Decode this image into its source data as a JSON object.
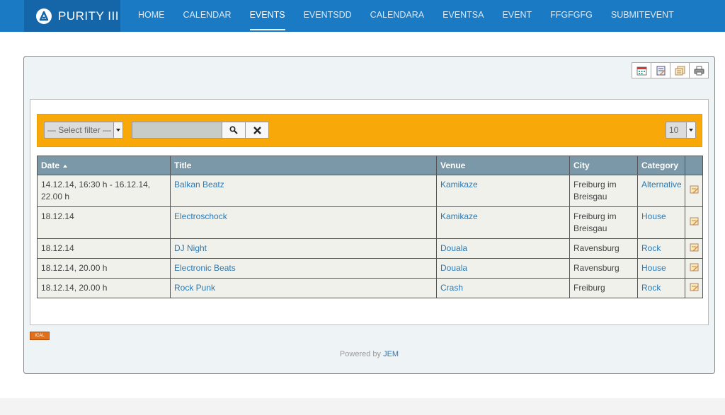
{
  "brand": {
    "name": "PURITY III"
  },
  "nav": [
    {
      "label": "HOME"
    },
    {
      "label": "CALENDAR"
    },
    {
      "label": "EVENTS",
      "active": true
    },
    {
      "label": "EVENTSDD"
    },
    {
      "label": "CALENDARA"
    },
    {
      "label": "EVENTSA"
    },
    {
      "label": "EVENT"
    },
    {
      "label": "FFGFGFG"
    },
    {
      "label": "SUBMITEVENT"
    }
  ],
  "toolbar": {
    "icons": [
      "calendar-icon",
      "submit-event-icon",
      "archive-icon",
      "print-icon"
    ]
  },
  "filter": {
    "select_label": "— Select filter —",
    "search_value": "",
    "limit_value": "10"
  },
  "table": {
    "headers": {
      "date": "Date",
      "title": "Title",
      "venue": "Venue",
      "city": "City",
      "category": "Category"
    },
    "rows": [
      {
        "date": "14.12.14, 16:30 h - 16.12.14, 22.00 h",
        "title": "Balkan Beatz",
        "venue": "Kamikaze",
        "city": "Freiburg im Breisgau",
        "category": "Alternative"
      },
      {
        "date": "18.12.14",
        "title": "Electroschock",
        "venue": "Kamikaze",
        "city": "Freiburg im Breisgau",
        "category": "House"
      },
      {
        "date": "18.12.14",
        "title": "DJ Night",
        "venue": "Douala",
        "city": "Ravensburg",
        "category": "Rock"
      },
      {
        "date": "18.12.14, 20.00 h",
        "title": "Electronic Beats",
        "venue": "Douala",
        "city": "Ravensburg",
        "category": "House"
      },
      {
        "date": "18.12.14, 20.00 h",
        "title": "Rock Punk",
        "venue": "Crash",
        "city": "Freiburg",
        "category": "Rock"
      }
    ]
  },
  "ical_label": "ICAL",
  "footer": {
    "powered_by": "Powered by",
    "link": "JEM"
  },
  "colors": {
    "topbar": "#1a7ac4",
    "filterbar": "#f8a808",
    "table_header": "#7b98a8",
    "link": "#2a7ab5"
  }
}
